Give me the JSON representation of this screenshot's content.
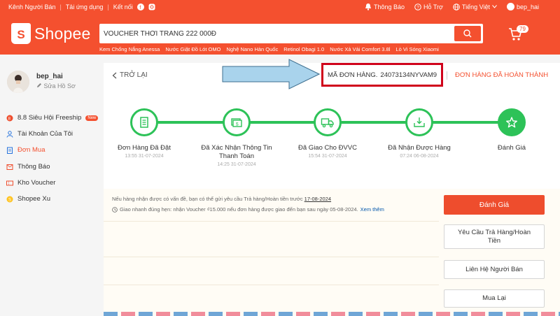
{
  "topbar": {
    "seller_centre": "Kênh Người Bán",
    "download_app": "Tải ứng dụng",
    "connect": "Kết nối",
    "notifications": "Thông Báo",
    "support": "Hỗ Trợ",
    "language": "Tiếng Việt",
    "username": "bep_hai"
  },
  "brand": {
    "name": "Shopee",
    "logo_letter": "S",
    "accent": "#f4502f"
  },
  "search": {
    "value": "VOUCHER THỜI TRANG 222 000Đ",
    "keywords": [
      "Kem Chống Nắng Anessa",
      "Nước Giặt Đồ Lót OMO",
      "Nghệ Nano Hàn Quốc",
      "Retinol Obagi 1.0",
      "Nước Xả Vải Comfort 3.8l",
      "Lò Vi Sóng Xiaomi"
    ]
  },
  "cart": {
    "count": "79"
  },
  "sidebar": {
    "username": "bep_hai",
    "edit_profile": "Sửa Hồ Sơ",
    "items": [
      {
        "label": "8.8 Siêu Hội Freeship",
        "badge": "New"
      },
      {
        "label": "Tài Khoản Của Tôi"
      },
      {
        "label": "Đơn Mua"
      },
      {
        "label": "Thông Báo"
      },
      {
        "label": "Kho Voucher"
      },
      {
        "label": "Shopee Xu"
      }
    ]
  },
  "order": {
    "back": "TRỞ LẠI",
    "code_label": "MÃ ĐƠN HÀNG.",
    "code": "24073134NYVAM9",
    "status": "ĐƠN HÀNG ĐÃ HOÀN THÀNH",
    "steps": [
      {
        "label": "Đơn Hàng Đã Đặt",
        "time": "13:55 31-07-2024"
      },
      {
        "label": "Đã Xác Nhận Thông Tin Thanh Toán",
        "time": "14:25 31-07-2024"
      },
      {
        "label": "Đã Giao Cho ĐVVC",
        "time": "15:54 31-07-2024"
      },
      {
        "label": "Đã Nhận Được Hàng",
        "time": "07:24 06-08-2024"
      },
      {
        "label": "Đánh Giá",
        "time": ""
      }
    ]
  },
  "notice": {
    "line1": "Nếu hàng nhận được có vấn đề, bạn có thể gửi yêu cầu Trả hàng/Hoàn tiền trước",
    "line1_date": "17-08-2024",
    "line2": "Giao nhanh đúng hẹn: nhận Voucher ₫15.000 nếu đơn hàng được giao đến bạn sau ngày 05-08-2024.",
    "see_more": "Xem thêm"
  },
  "actions": {
    "rate": "Đánh Giá",
    "return_request": "Yêu Cầu Trả Hàng/Hoàn Tiền",
    "contact_seller": "Liên Hệ Người Bán",
    "buy_again": "Mua Lại"
  }
}
